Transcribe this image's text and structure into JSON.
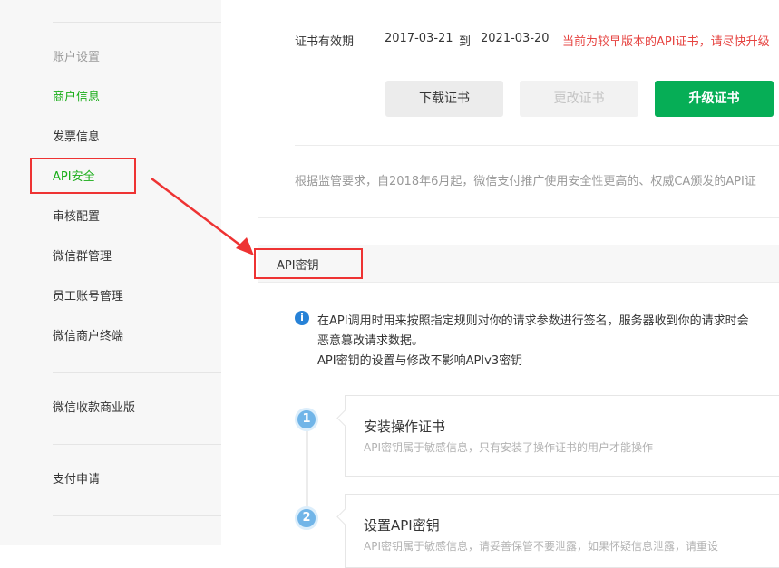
{
  "sidebar": {
    "group_label": "账户设置",
    "items": [
      {
        "label": "商户信息"
      },
      {
        "label": "发票信息"
      },
      {
        "label": "API安全"
      },
      {
        "label": "审核配置"
      },
      {
        "label": "微信群管理"
      },
      {
        "label": "员工账号管理"
      },
      {
        "label": "微信商户终端"
      }
    ],
    "business_version": "微信收款商业版",
    "payment_apply": "支付申请"
  },
  "certificate": {
    "validity_label": "证书有效期",
    "start_date": "2017-03-21",
    "to_word": "到",
    "end_date": "2021-03-20",
    "warning": "当前为较早版本的API证书，请尽快升级",
    "download_label": "下载证书",
    "change_label": "更改证书",
    "upgrade_label": "升级证书",
    "notice": "根据监管要求，自2018年6月起，微信支付推广使用安全性更高的、权威CA颁发的API证"
  },
  "api_key_section": {
    "title": "API密钥",
    "info_lines": [
      "在API调用时用来按照指定规则对你的请求参数进行签名，服务器收到你的请求时会",
      "恶意篡改请求数据。",
      "API密钥的设置与修改不影响APIv3密钥"
    ],
    "steps": [
      {
        "number": "1",
        "title": "安装操作证书",
        "desc": "API密钥属于敏感信息，只有安装了操作证书的用户才能操作"
      },
      {
        "number": "2",
        "title": "设置API密钥",
        "desc": "API密钥属于敏感信息，请妥善保管不要泄露，如果怀疑信息泄露，请重设"
      }
    ]
  },
  "colors": {
    "active_green": "#1aad19",
    "upgrade_button": "#06ae56",
    "warning_red": "#e64340",
    "annotation_red": "#ee3333",
    "info_blue": "#2782d7",
    "step_blue": "#71b5e8"
  }
}
